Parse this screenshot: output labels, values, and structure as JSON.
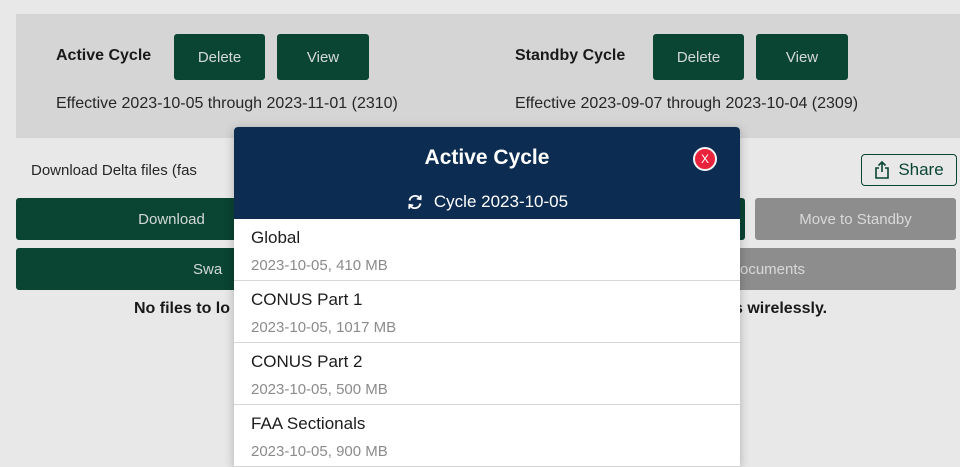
{
  "active_cycle": {
    "label": "Active Cycle",
    "delete_label": "Delete",
    "view_label": "View",
    "effective": "Effective 2023-10-05 through 2023-11-01 (2310)"
  },
  "standby_cycle": {
    "label": "Standby Cycle",
    "delete_label": "Delete",
    "view_label": "View",
    "effective": "Effective 2023-09-07 through 2023-10-04 (2309)"
  },
  "delta": {
    "text": "Download Delta files (fas"
  },
  "share": {
    "label": "Share",
    "icon": "share-icon"
  },
  "actions": {
    "download_label": "Download",
    "move_standby_label": "Move to Standby",
    "swap_label": "Swa",
    "documents_label": "ocuments"
  },
  "status": {
    "left": "No files to lo",
    "right": "s wirelessly."
  },
  "modal": {
    "title": "Active Cycle",
    "close_label": "X",
    "cycle_label": "Cycle 2023-10-05",
    "items": [
      {
        "title": "Global",
        "subtitle": "2023-10-05, 410 MB"
      },
      {
        "title": "CONUS Part 1",
        "subtitle": "2023-10-05, 1017 MB"
      },
      {
        "title": "CONUS Part 2",
        "subtitle": "2023-10-05, 500 MB"
      },
      {
        "title": "FAA Sectionals",
        "subtitle": "2023-10-05, 900 MB"
      }
    ]
  },
  "colors": {
    "primary_green": "#0b4b39",
    "modal_navy": "#0d2c52",
    "close_red": "#e8233b",
    "disabled_grey": "#9c9c9c"
  }
}
